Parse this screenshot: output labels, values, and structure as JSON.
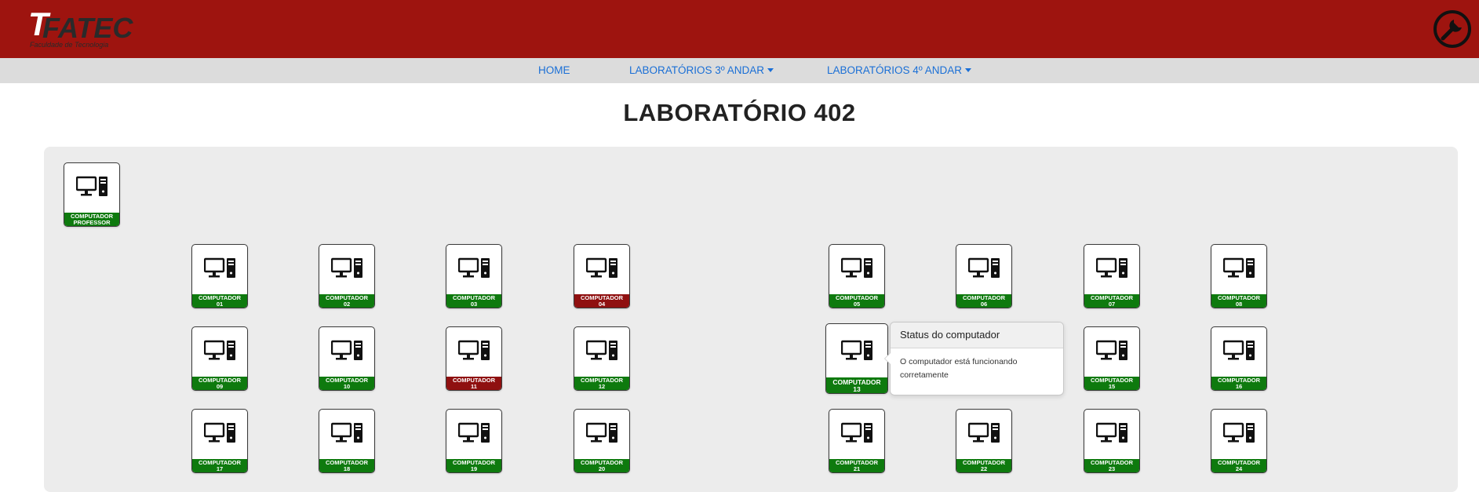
{
  "header": {
    "logo_text": "FATEC",
    "logo_subtitle": "Faculdade de Tecnologia",
    "settings_icon": "wrench-icon",
    "colors": {
      "brand": "#9e140f",
      "nav_bg": "#dcdcdc",
      "link": "#1a6fd6"
    }
  },
  "nav": {
    "home": "HOME",
    "labs_3": "LABORATÓRIOS 3º ANDAR",
    "labs_4": "LABORATÓRIOS 4º ANDAR"
  },
  "page": {
    "title": "LABORATÓRIO 402"
  },
  "status_colors": {
    "ok": "#0e7a0e",
    "error": "#8f1010"
  },
  "professor": {
    "line1": "COMPUTADOR",
    "line2": "PROFESSOR",
    "status": "ok"
  },
  "computers": [
    {
      "line1": "COMPUTADOR",
      "line2": "01",
      "status": "ok"
    },
    {
      "line1": "COMPUTADOR",
      "line2": "02",
      "status": "ok"
    },
    {
      "line1": "COMPUTADOR",
      "line2": "03",
      "status": "ok"
    },
    {
      "line1": "COMPUTADOR",
      "line2": "04",
      "status": "error"
    },
    {
      "line1": "COMPUTADOR",
      "line2": "05",
      "status": "ok"
    },
    {
      "line1": "COMPUTADOR",
      "line2": "06",
      "status": "ok"
    },
    {
      "line1": "COMPUTADOR",
      "line2": "07",
      "status": "ok"
    },
    {
      "line1": "COMPUTADOR",
      "line2": "08",
      "status": "ok"
    },
    {
      "line1": "COMPUTADOR",
      "line2": "09",
      "status": "ok"
    },
    {
      "line1": "COMPUTADOR",
      "line2": "10",
      "status": "ok"
    },
    {
      "line1": "COMPUTADOR",
      "line2": "11",
      "status": "error"
    },
    {
      "line1": "COMPUTADOR",
      "line2": "12",
      "status": "ok"
    },
    {
      "line1": "COMPUTADOR",
      "line2": "13",
      "status": "ok"
    },
    {
      "line1": "COMPUTADOR",
      "line2": "15",
      "status": "ok"
    },
    {
      "line1": "COMPUTADOR",
      "line2": "16",
      "status": "ok"
    },
    {
      "line1": "COMPUTADOR",
      "line2": "17",
      "status": "ok"
    },
    {
      "line1": "COMPUTADOR",
      "line2": "18",
      "status": "ok"
    },
    {
      "line1": "COMPUTADOR",
      "line2": "19",
      "status": "ok"
    },
    {
      "line1": "COMPUTADOR",
      "line2": "20",
      "status": "ok"
    },
    {
      "line1": "COMPUTADOR",
      "line2": "21",
      "status": "ok"
    },
    {
      "line1": "COMPUTADOR",
      "line2": "22",
      "status": "ok"
    },
    {
      "line1": "COMPUTADOR",
      "line2": "23",
      "status": "ok"
    },
    {
      "line1": "COMPUTADOR",
      "line2": "24",
      "status": "ok"
    }
  ],
  "popover": {
    "title": "Status do computador",
    "body": "O computador está funcionando corretamente"
  }
}
